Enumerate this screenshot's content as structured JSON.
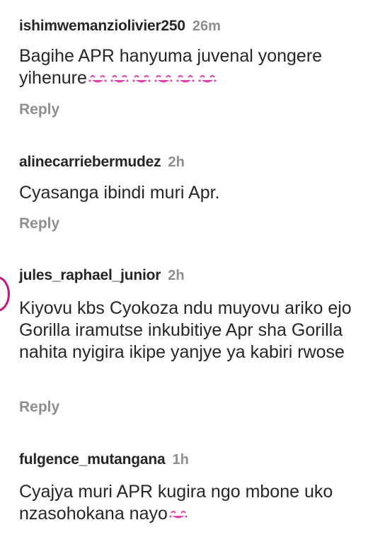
{
  "comments": [
    {
      "username": "ishimwemanziolivier250",
      "time": "26m",
      "text": "Bagihe APR  hanyuma juvenal yongere yihenure",
      "emoji": [
        "laughing-face-icon",
        "laughing-face-icon",
        "laughing-face-icon",
        "laughing-face-icon",
        "laughing-face-icon",
        "laughing-face-icon"
      ],
      "reply_label": "Reply"
    },
    {
      "username": "alinecarriebermudez",
      "time": "2h",
      "text": "Cyasanga ibindi muri Apr.",
      "reply_label": "Reply"
    },
    {
      "username": "jules_raphael_junior",
      "time": "2h",
      "text": "Kiyovu kbs Cyokoza ndu muyovu ariko ejo Gorilla iramutse inkubitiye Apr sha Gorilla nahita nyigira ikipe yanjye ya kabiri rwose",
      "reply_label": "Reply"
    },
    {
      "username": "fulgence_mutangana",
      "time": "1h",
      "text": "Cyajya muri APR kugira ngo mbone uko nzasohokana nayo",
      "emoji": [
        "laughing-face-icon"
      ]
    }
  ],
  "colors": {
    "text": "#262626",
    "secondary": "#8e8e8e",
    "emoji": "#e33fb0",
    "story_ring": "#c8127f"
  }
}
